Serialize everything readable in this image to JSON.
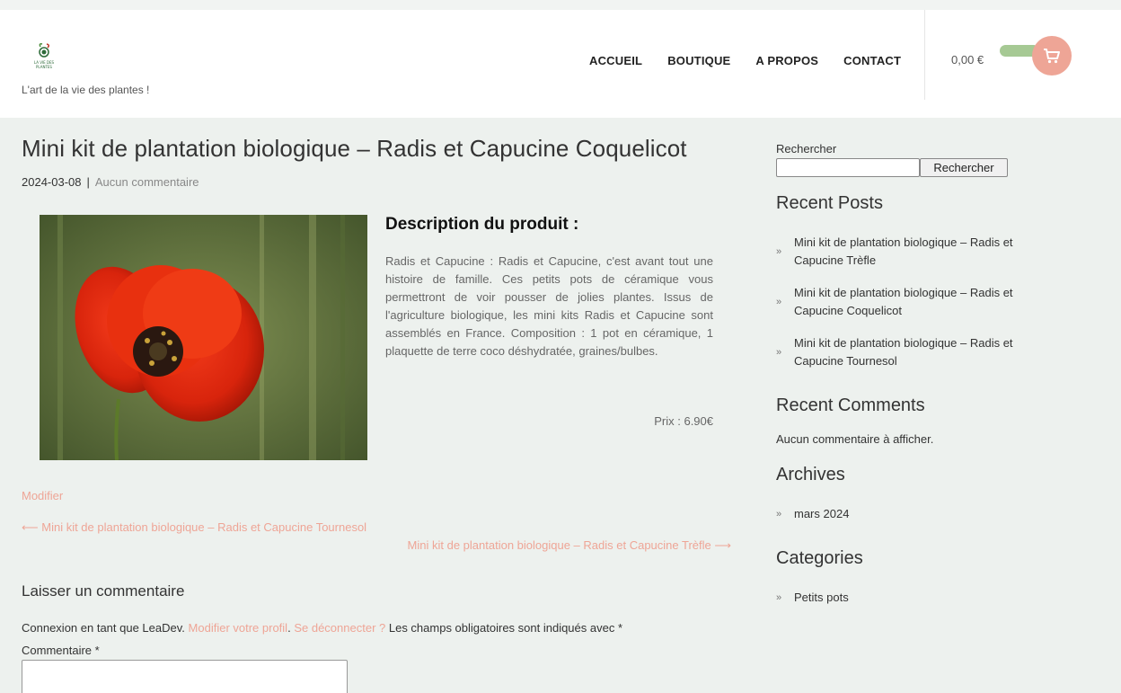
{
  "header": {
    "logo_text": "LA VIE DES PLANTES",
    "tagline": "L'art de la vie des plantes !",
    "nav": [
      "ACCUEIL",
      "BOUTIQUE",
      "A PROPOS",
      "CONTACT"
    ],
    "cart_total": "0,00 €"
  },
  "post": {
    "title": "Mini kit de plantation biologique – Radis et Capucine Coquelicot",
    "date": "2024-03-08",
    "separator": "|",
    "comments_link": "Aucun commentaire",
    "desc_heading": "Description du produit :",
    "desc_text": "Radis et Capucine : Radis et Capucine, c'est avant tout une histoire de famille. Ces petits pots de céramique vous permettront de voir pousser de jolies plantes. Issus de l'agriculture biologique, les mini kits Radis et Capucine sont assemblés en France. Composition : 1 pot en céramique, 1 plaquette de terre coco déshydratée, graines/bulbes.",
    "price": "Prix : 6.90€",
    "edit_link": "Modifier",
    "prev_link": "⟵ Mini kit de plantation biologique – Radis et Capucine Tournesol",
    "next_link": "Mini kit de plantation biologique – Radis et Capucine Trèfle ⟶"
  },
  "comment_form": {
    "title": "Laisser un commentaire",
    "logged_in_prefix": "Connexion en tant que LeaDev.",
    "edit_profile": "Modifier votre profil",
    "dot": ".",
    "logout": "Se déconnecter ?",
    "required_note": "Les champs obligatoires sont indiqués avec *",
    "comment_label": "Commentaire *"
  },
  "sidebar": {
    "search_label": "Rechercher",
    "search_button": "Rechercher",
    "recent_posts_title": "Recent Posts",
    "recent_posts": [
      "Mini kit de plantation biologique – Radis et Capucine Trèfle",
      "Mini kit de plantation biologique – Radis et Capucine Coquelicot",
      "Mini kit de plantation biologique – Radis et Capucine Tournesol"
    ],
    "recent_comments_title": "Recent Comments",
    "no_comments": "Aucun commentaire à afficher.",
    "archives_title": "Archives",
    "archives": [
      "mars 2024"
    ],
    "categories_title": "Categories",
    "categories": [
      "Petits pots"
    ]
  },
  "colors": {
    "accent_link": "#eea596",
    "cart_pill": "#a6c994",
    "page_bg": "#edf1ee"
  },
  "icons": {
    "cart": "cart-icon",
    "arrow": "double-chevron-right-icon"
  }
}
